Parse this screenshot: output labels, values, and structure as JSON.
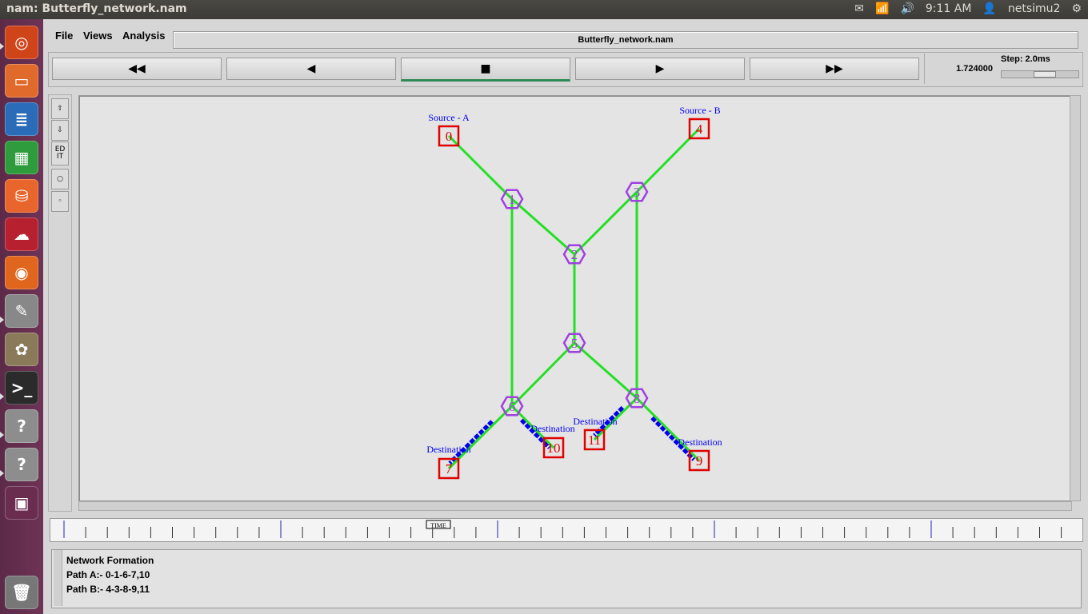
{
  "window": {
    "title": "nam: Butterfly_network.nam"
  },
  "systray": {
    "clock": "9:11 AM",
    "user": "netsimu2",
    "mail_icon": "envelope-icon",
    "network_icon": "network-icon",
    "volume_icon": "volume-icon",
    "settings_icon": "gear-icon"
  },
  "launcher": {
    "items": [
      {
        "name": "ubuntu-dash",
        "icon": "ubuntu-logo-icon",
        "color": "#d0441a"
      },
      {
        "name": "files",
        "icon": "folder-icon",
        "color": "#e06a2b"
      },
      {
        "name": "writer",
        "icon": "document-icon",
        "color": "#2a6cb8"
      },
      {
        "name": "calc",
        "icon": "spreadsheet-icon",
        "color": "#2e9b3c"
      },
      {
        "name": "software-center",
        "icon": "shopping-bag-icon",
        "color": "#e8652b"
      },
      {
        "name": "ubuntu-one",
        "icon": "cloud-icon",
        "color": "#b7212f"
      },
      {
        "name": "firefox",
        "icon": "firefox-icon",
        "color": "#e0661d"
      },
      {
        "name": "text-editor",
        "icon": "text-editor-icon",
        "color": "#888888"
      },
      {
        "name": "gimp",
        "icon": "gimp-icon",
        "color": "#8a7a5a"
      },
      {
        "name": "terminal",
        "icon": "terminal-icon",
        "color": "#2b2b2b"
      },
      {
        "name": "unknown-app-1",
        "icon": "question-icon",
        "color": "#8d8d8d"
      },
      {
        "name": "unknown-app-2",
        "icon": "question-icon",
        "color": "#8d8d8d"
      },
      {
        "name": "workspace-switcher",
        "icon": "workspaces-icon",
        "color": "#6a2d50"
      },
      {
        "name": "trash",
        "icon": "trash-icon",
        "color": "#777777"
      }
    ]
  },
  "menu": {
    "file": "File",
    "views": "Views",
    "analysis": "Analysis"
  },
  "file_label": "Butterfly_network.nam",
  "controls": {
    "rewind": "◀◀",
    "back": "◀",
    "stop": "■",
    "play": "▶",
    "fast_forward": "▶▶",
    "time": "1.724000",
    "step": "Step: 2.0ms"
  },
  "toolbar": {
    "edit": "ED IT"
  },
  "network": {
    "link_color": "#22e022",
    "packet_color": "#0000ee",
    "node_label_color": "#0000ee",
    "node_colors": {
      "square": "#e00000",
      "hexagon": "#a040e0"
    },
    "nodes": [
      {
        "id": "0",
        "shape": "square",
        "label": "Source - A"
      },
      {
        "id": "1",
        "shape": "hexagon",
        "label": ""
      },
      {
        "id": "2",
        "shape": "hexagon",
        "label": ""
      },
      {
        "id": "3",
        "shape": "hexagon",
        "label": ""
      },
      {
        "id": "4",
        "shape": "square",
        "label": "Source - B"
      },
      {
        "id": "5",
        "shape": "hexagon",
        "label": ""
      },
      {
        "id": "6",
        "shape": "hexagon",
        "label": ""
      },
      {
        "id": "7",
        "shape": "square",
        "label": "Destination"
      },
      {
        "id": "8",
        "shape": "hexagon",
        "label": ""
      },
      {
        "id": "9",
        "shape": "square",
        "label": "Destination"
      },
      {
        "id": "10",
        "shape": "square",
        "label": "Destination"
      },
      {
        "id": "11",
        "shape": "square",
        "label": "Destination"
      }
    ],
    "links": [
      [
        "0",
        "1"
      ],
      [
        "1",
        "2"
      ],
      [
        "4",
        "3"
      ],
      [
        "3",
        "2"
      ],
      [
        "1",
        "6"
      ],
      [
        "2",
        "5"
      ],
      [
        "3",
        "8"
      ],
      [
        "5",
        "6"
      ],
      [
        "5",
        "8"
      ],
      [
        "6",
        "7"
      ],
      [
        "6",
        "10"
      ],
      [
        "8",
        "11"
      ],
      [
        "8",
        "9"
      ]
    ]
  },
  "timeline": {
    "label": "TIME"
  },
  "annotations": [
    "Network Formation",
    "Path A:- 0-1-6-7,10",
    "Path B:- 4-3-8-9,11"
  ]
}
